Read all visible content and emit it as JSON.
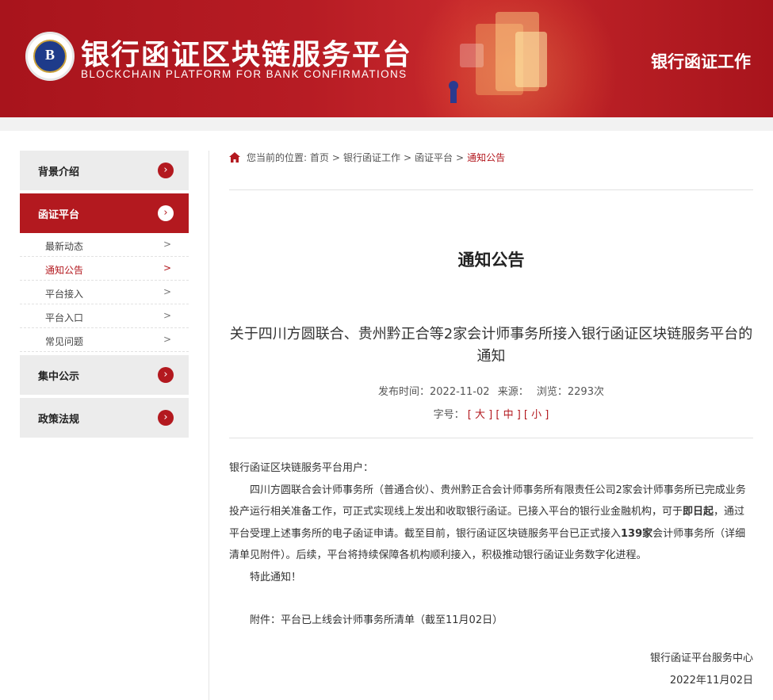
{
  "header": {
    "logo_text": "B",
    "title": "银行函证区块链服务平台",
    "subtitle": "BLOCKCHAIN PLATFORM FOR BANK CONFIRMATIONS",
    "right_title": "银行函证工作"
  },
  "sidebar": {
    "sections": [
      {
        "label": "背景介绍",
        "arrow": "›"
      },
      {
        "label": "函证平台",
        "arrow": "›",
        "active": true
      },
      {
        "label": "集中公示",
        "arrow": "›"
      },
      {
        "label": "政策法规",
        "arrow": "›"
      }
    ],
    "sub_items": [
      {
        "label": "最新动态",
        "chev": ">"
      },
      {
        "label": "通知公告",
        "chev": ">",
        "current": true
      },
      {
        "label": "平台接入",
        "chev": ">"
      },
      {
        "label": "平台入口",
        "chev": ">"
      },
      {
        "label": "常见问题",
        "chev": ">"
      }
    ]
  },
  "breadcrumb": {
    "prefix": "您当前的位置:",
    "items": [
      "首页",
      "银行函证工作",
      "函证平台",
      "通知公告"
    ],
    "separator": ">"
  },
  "main": {
    "section_title": "通知公告",
    "article_title": "关于四川方圆联合、贵州黔正合等2家会计师事务所接入银行函证区块链服务平台的通知",
    "meta": {
      "publish": "发布时间：2022-11-02",
      "source": "来源：",
      "views": "浏览：2293次"
    },
    "font_size": {
      "label": "字号：",
      "large": "[ 大 ]",
      "medium": "[ 中 ]",
      "small": "[ 小 ]"
    },
    "body": {
      "greeting": "银行函证区块链服务平台用户：",
      "para1_a": "四川方圆联合会计师事务所（普通合伙）、贵州黔正合会计师事务所有限责任公司2家会计师事务所已完成业务投产运行相关准备工作，可正式实现线上发出和收取银行函证。已接入平台的银行业金融机构，可于",
      "para1_bold1": "即日起",
      "para1_b": "，通过平台受理上述事务所的电子函证申请。截至目前，银行函证区块链服务平台已正式接入",
      "para1_bold2": "139家",
      "para1_c": "会计师事务所（详细清单见附件）。后续，平台将持续保障各机构顺利接入，积极推动银行函证业务数字化进程。",
      "para2": "特此通知！",
      "attachment": "附件：平台已上线会计师事务所清单（截至11月02日）"
    },
    "signature": {
      "org": "银行函证平台服务中心",
      "date": "2022年11月02日"
    }
  },
  "colors": {
    "brand_red": "#b3191f",
    "sidebar_bg": "#ececec"
  }
}
